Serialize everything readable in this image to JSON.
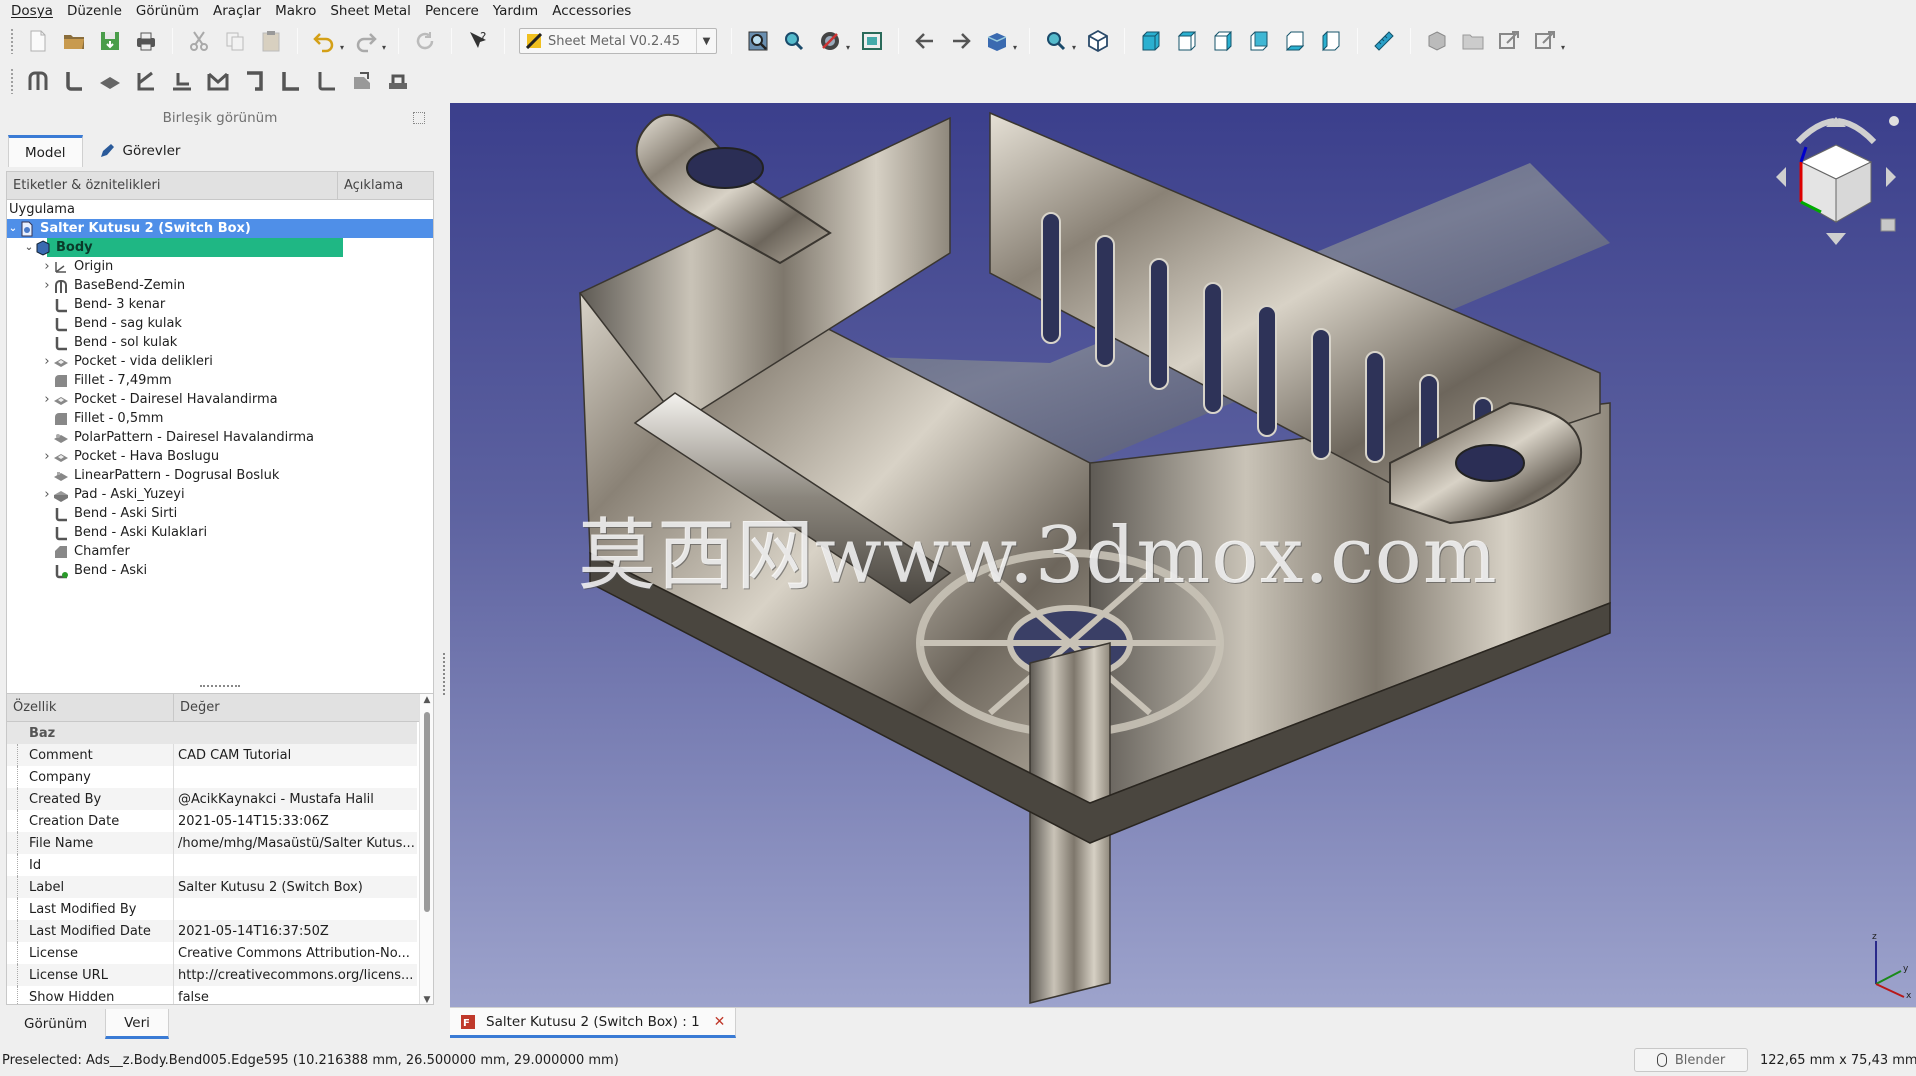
{
  "menubar": {
    "items": [
      "Dosya",
      "Düzenle",
      "Görünüm",
      "Araçlar",
      "Makro",
      "Sheet Metal",
      "Pencere",
      "Yardım",
      "Accessories"
    ]
  },
  "toolbar": {
    "workbench": "Sheet Metal V0.2.45"
  },
  "combo_view": {
    "title": "Birleşik görünüm",
    "tabs": [
      "Model",
      "Görevler"
    ],
    "tree_headers": [
      "Etiketler & öznitelikleri",
      "Açıklama"
    ],
    "application_label": "Uygulama",
    "document": "Salter Kutusu 2 (Switch Box)",
    "body": "Body",
    "features": [
      {
        "label": "Origin",
        "icon": "origin-icon",
        "expandable": true
      },
      {
        "label": "BaseBend-Zemin",
        "icon": "basebend-icon",
        "expandable": true
      },
      {
        "label": "Bend- 3 kenar",
        "icon": "bend-icon",
        "expandable": false
      },
      {
        "label": "Bend - sag kulak",
        "icon": "bend-icon",
        "expandable": false
      },
      {
        "label": "Bend - sol kulak",
        "icon": "bend-icon",
        "expandable": false
      },
      {
        "label": "Pocket - vida delikleri",
        "icon": "pocket-icon",
        "expandable": true
      },
      {
        "label": "Fillet - 7,49mm",
        "icon": "fillet-icon",
        "expandable": false
      },
      {
        "label": "Pocket - Dairesel Havalandirma",
        "icon": "pocket-icon",
        "expandable": true
      },
      {
        "label": "Fillet - 0,5mm",
        "icon": "fillet-icon",
        "expandable": false
      },
      {
        "label": "PolarPattern - Dairesel Havalandirma",
        "icon": "polar-pattern-icon",
        "expandable": false
      },
      {
        "label": "Pocket - Hava Boslugu",
        "icon": "pocket-icon",
        "expandable": true
      },
      {
        "label": "LinearPattern - Dogrusal Bosluk",
        "icon": "linear-pattern-icon",
        "expandable": false
      },
      {
        "label": "Pad - Aski_Yuzeyi",
        "icon": "pad-icon",
        "expandable": true
      },
      {
        "label": "Bend - Aski Sirti",
        "icon": "bend-icon",
        "expandable": false
      },
      {
        "label": "Bend - Aski Kulaklari",
        "icon": "bend-icon",
        "expandable": false
      },
      {
        "label": "Chamfer",
        "icon": "chamfer-icon",
        "expandable": false
      },
      {
        "label": "Bend - Aski",
        "icon": "bend-tip-icon",
        "expandable": false
      }
    ]
  },
  "property_view": {
    "headers": [
      "Özellik",
      "Değer"
    ],
    "group": "Baz",
    "rows": [
      {
        "name": "Comment",
        "value": "CAD CAM Tutorial"
      },
      {
        "name": "Company",
        "value": ""
      },
      {
        "name": "Created By",
        "value": "@AcikKaynakci - Mustafa Halil"
      },
      {
        "name": "Creation Date",
        "value": "2021-05-14T15:33:06Z"
      },
      {
        "name": "File Name",
        "value": "/home/mhg/Masaüstü/Salter Kutus..."
      },
      {
        "name": "Id",
        "value": ""
      },
      {
        "name": "Label",
        "value": "Salter Kutusu 2 (Switch Box)"
      },
      {
        "name": "Last Modified By",
        "value": ""
      },
      {
        "name": "Last Modified Date",
        "value": "2021-05-14T16:37:50Z"
      },
      {
        "name": "License",
        "value": "Creative Commons Attribution-No..."
      },
      {
        "name": "License URL",
        "value": "http://creativecommons.org/licens..."
      },
      {
        "name": "Show Hidden",
        "value": "false"
      }
    ],
    "bottom_tabs": [
      "Görünüm",
      "Veri"
    ]
  },
  "viewport": {
    "watermark": "莫西网www.3dmox.com",
    "background_top": "#3b3f8c",
    "background_bottom": "#9da3cc"
  },
  "document_tab": {
    "label": "Salter Kutusu 2 (Switch Box) : 1"
  },
  "statusbar": {
    "preselected": "Preselected: Ads__z.Body.Bend005.Edge595 (10.216388 mm, 26.500000 mm, 29.000000 mm)",
    "navigation_style": "Blender",
    "dimensions": "122,65 mm x 75,43 mm"
  },
  "colors": {
    "selection_blue": "#4f8fe8",
    "body_green": "#1fb784",
    "tab_accent": "#3a7bd5"
  }
}
